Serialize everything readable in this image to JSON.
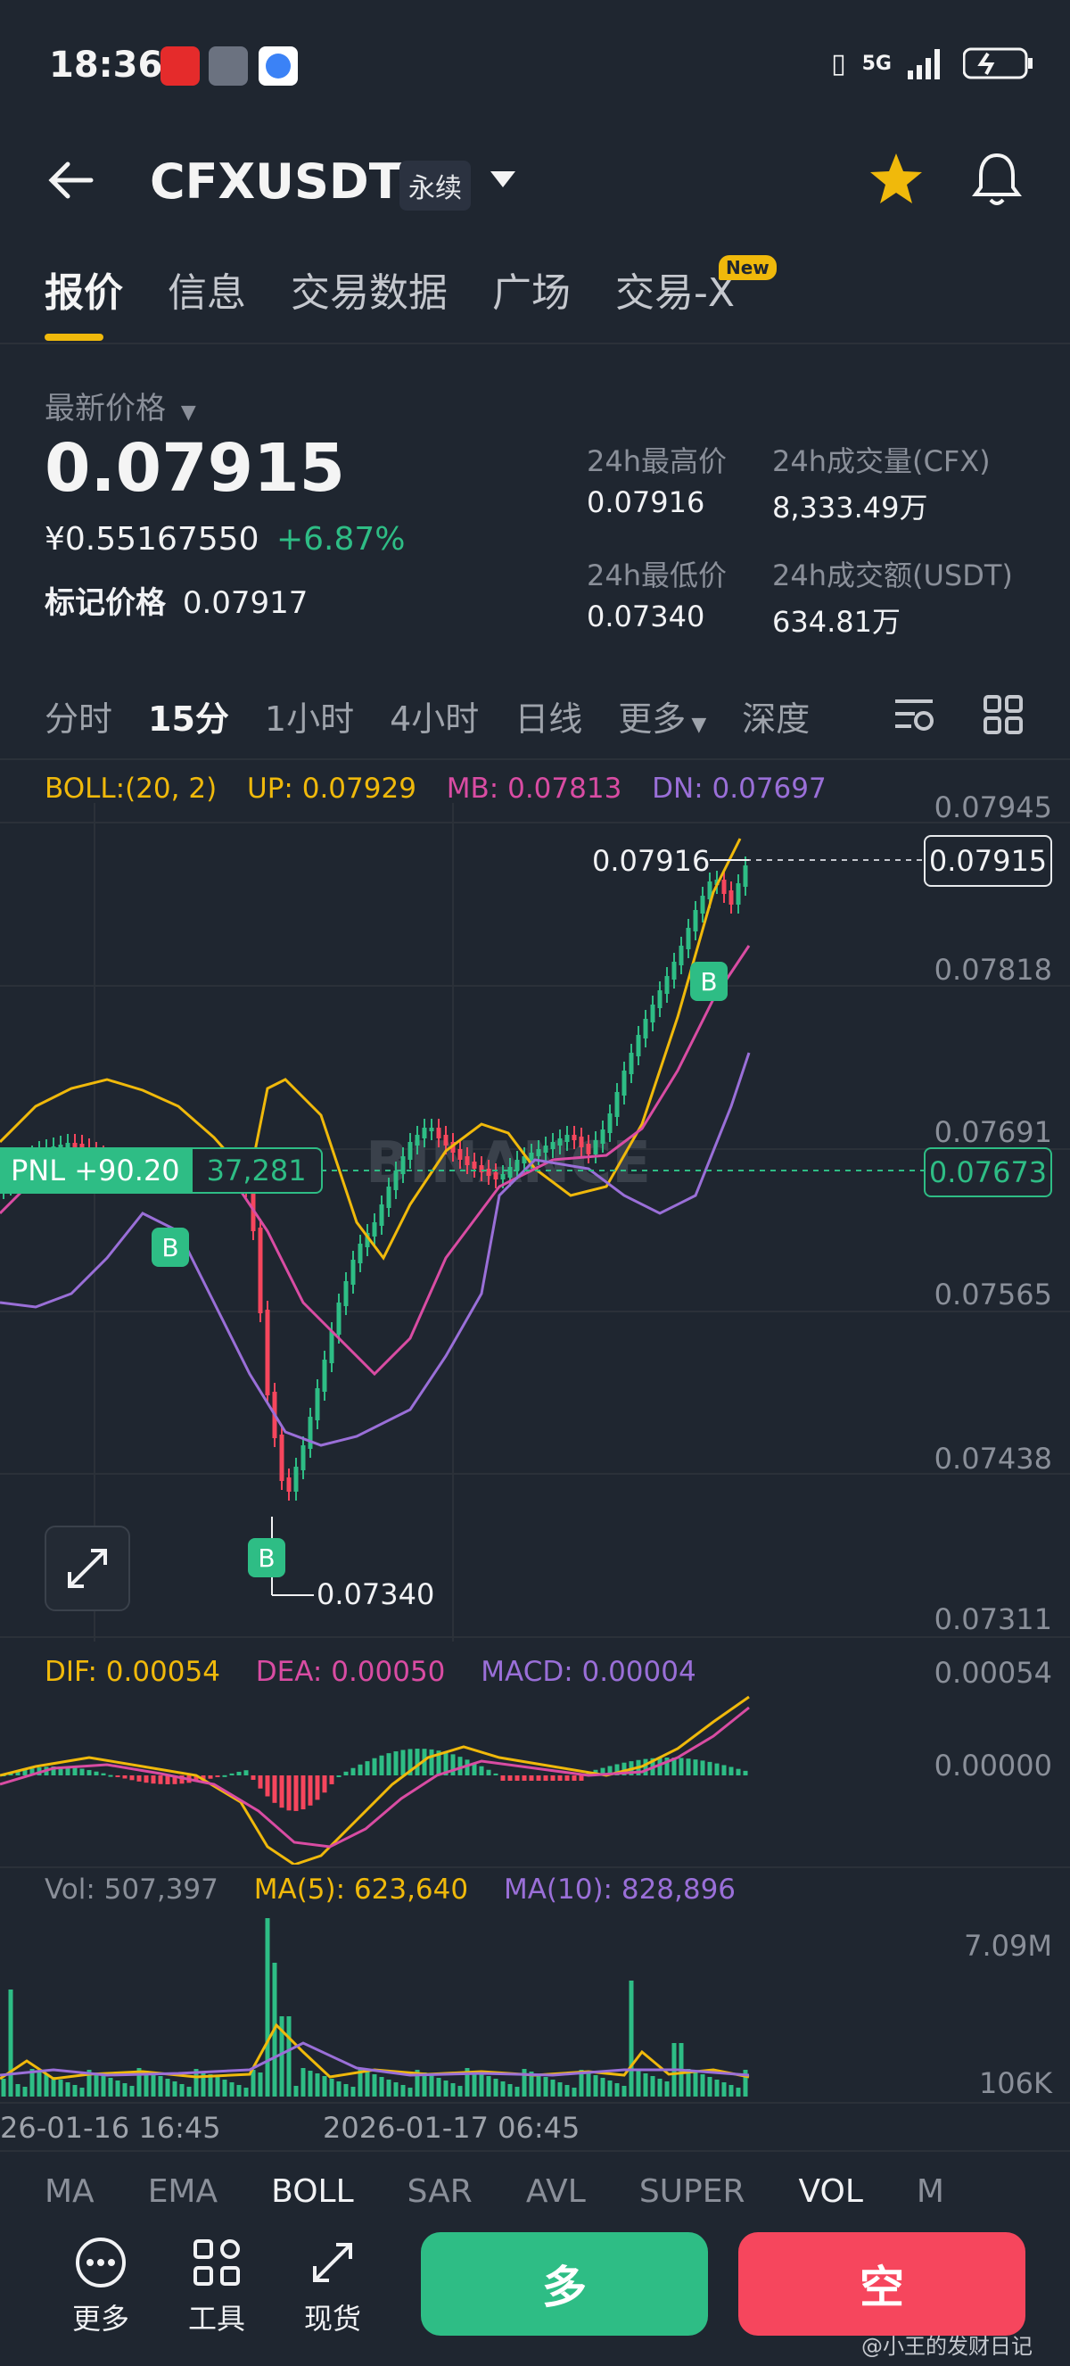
{
  "status": {
    "time": "18:36",
    "network": "5G"
  },
  "header": {
    "symbol": "CFXUSDT",
    "contract_type": "永续"
  },
  "tabs": [
    "报价",
    "信息",
    "交易数据",
    "广场",
    "交易-X"
  ],
  "new_badge": "New",
  "price": {
    "label": "最新价格",
    "last": "0.07915",
    "cny": "¥0.55167550",
    "change": "+6.87%",
    "mark_label": "标记价格",
    "mark": "0.07917"
  },
  "stats": {
    "high_label": "24h最高价",
    "high": "0.07916",
    "vol_label": "24h成交量(CFX)",
    "vol": "8,333.49万",
    "low_label": "24h最低价",
    "low": "0.07340",
    "amount_label": "24h成交额(USDT)",
    "amount": "634.81万"
  },
  "intervals": [
    "分时",
    "15分",
    "1小时",
    "4小时",
    "日线",
    "更多",
    "深度"
  ],
  "boll": {
    "title": "BOLL:(20, 2)",
    "up": "UP: 0.07929",
    "mb": "MB: 0.07813",
    "dn": "DN: 0.07697"
  },
  "y_axis": [
    "0.07945",
    "0.07818",
    "0.07691",
    "0.07565",
    "0.07438",
    "0.07311"
  ],
  "price_tag": "0.07915",
  "entry_tag": "0.07673",
  "high_marker": "0.07916",
  "low_marker": "0.07340",
  "pnl": {
    "label": "PNL +90.20",
    "qty": "37,281"
  },
  "buy_marker": "B",
  "watermark": "BINANCE",
  "macd": {
    "dif": "DIF: 0.00054",
    "dea": "DEA: 0.00050",
    "macd": "MACD: 0.00004",
    "y_top": "0.00054",
    "y_zero": "0.00000"
  },
  "vol": {
    "vol": "Vol: 507,397",
    "ma5": "MA(5): 623,640",
    "ma10": "MA(10): 828,896",
    "y_top": "7.09M",
    "y_bottom": "106K"
  },
  "x_axis": [
    "26-01-16 16:45",
    "2026-01-17 06:45"
  ],
  "indicator_tabs": [
    "MA",
    "EMA",
    "BOLL",
    "SAR",
    "AVL",
    "SUPER",
    "VOL",
    "M"
  ],
  "tools": [
    "更多",
    "工具",
    "现货"
  ],
  "buttons": {
    "long": "多",
    "short": "空"
  },
  "footer_watermark": "@小王的发财日记",
  "colors": {
    "green": "#2ebd85",
    "red": "#f6465d",
    "yellow": "#f0b90b",
    "pink": "#d94ca3",
    "purple": "#9a6fd8"
  }
}
